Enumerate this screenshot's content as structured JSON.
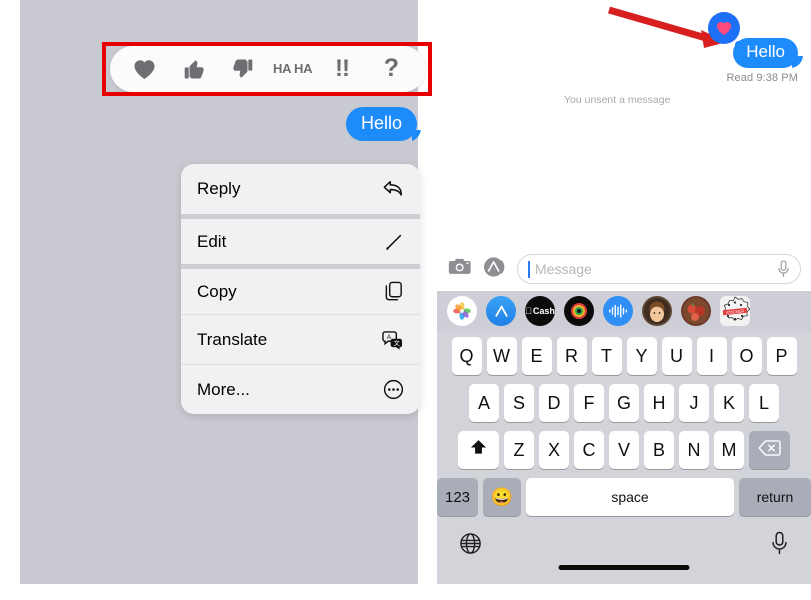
{
  "left_panel": {
    "reaction_bar": {
      "highlighted": true,
      "highlight_color": "#e60000",
      "items": [
        {
          "name": "heart",
          "label": ""
        },
        {
          "name": "thumbs-up",
          "label": ""
        },
        {
          "name": "thumbs-down",
          "label": ""
        },
        {
          "name": "haha",
          "label": "HA HA"
        },
        {
          "name": "exclamation",
          "label": "!!"
        },
        {
          "name": "question",
          "label": "?"
        }
      ]
    },
    "message_bubble": {
      "text": "Hello",
      "color": "#1d8bfa"
    },
    "context_menu": {
      "items": [
        {
          "label": "Reply",
          "icon": "reply-arrow-icon"
        },
        {
          "label": "Edit",
          "icon": "pencil-icon"
        },
        {
          "label": "Copy",
          "icon": "copy-icon"
        },
        {
          "label": "Translate",
          "icon": "translate-icon"
        },
        {
          "label": "More...",
          "icon": "ellipsis-circle-icon"
        }
      ]
    }
  },
  "right_panel": {
    "message_bubble": {
      "text": "Hello",
      "color": "#1d8bfa"
    },
    "reaction_badge": {
      "icon": "heart-icon",
      "heart_color": "#ff4a7d",
      "bubble_color": "#1d6ff5"
    },
    "read_status": "Read 9:38 PM",
    "unsent_note": "You unsent a message",
    "annotation": {
      "arrow_color": "#d81f1f",
      "name": "red-arrow-pointer"
    },
    "input_bar": {
      "camera_icon": "camera-icon",
      "appstore_icon": "app-store-icon",
      "placeholder": "Message",
      "mic_icon": "microphone-icon"
    },
    "app_drawer": [
      {
        "name": "photos-app-icon",
        "label": ""
      },
      {
        "name": "app-store-app-icon",
        "label": ""
      },
      {
        "name": "apple-cash-app-icon",
        "label": "Cash"
      },
      {
        "name": "music-app-icon",
        "label": ""
      },
      {
        "name": "voice-memo-app-icon",
        "label": ""
      },
      {
        "name": "memoji-app-icon",
        "label": ""
      },
      {
        "name": "photo-thumbnail-icon",
        "label": ""
      },
      {
        "name": "sticker-app-icon",
        "label": ""
      }
    ],
    "keyboard": {
      "row1": [
        "Q",
        "W",
        "E",
        "R",
        "T",
        "Y",
        "U",
        "I",
        "O",
        "P"
      ],
      "row2": [
        "A",
        "S",
        "D",
        "F",
        "G",
        "H",
        "J",
        "K",
        "L"
      ],
      "row3": [
        "Z",
        "X",
        "C",
        "V",
        "B",
        "N",
        "M"
      ],
      "shift_key": "shift-icon",
      "backspace_key": "backspace-icon",
      "numbers_key": "123",
      "emoji_key": "emoji-icon",
      "space_key": "space",
      "return_key": "return",
      "globe_key": "globe-icon",
      "dictation_key": "microphone-icon"
    }
  }
}
